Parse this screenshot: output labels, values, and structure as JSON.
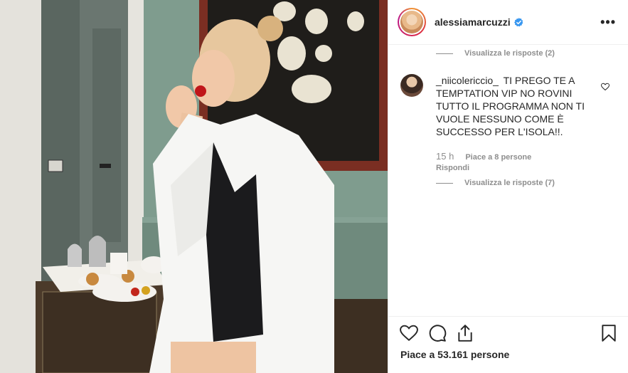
{
  "header": {
    "username": "alessiamarcuzzi",
    "more_label": "•••"
  },
  "comments": {
    "view_replies_top": "Visualizza le risposte (2)",
    "comment": {
      "username": "_niicolericcio_",
      "text": "TI PREGO TE A TEMPTATION VIP NO ROVINI TUTTO IL PROGRAMMA NON TI VUOLE NESSUNO COME È SUCCESSO PER L'ISOLA!!.",
      "time": "15 h",
      "likes": "Piace a 8 persone",
      "reply": "Rispondi",
      "view_replies": "Visualizza le risposte (7)"
    }
  },
  "actions": {
    "like_icon": "heart-icon",
    "comment_icon": "comment-icon",
    "share_icon": "share-icon",
    "save_icon": "bookmark-icon",
    "likes_text": "Piace a 53.161 persone"
  },
  "colors": {
    "verified": "#3897f0",
    "muted": "#8e8e8e",
    "text": "#262626"
  }
}
